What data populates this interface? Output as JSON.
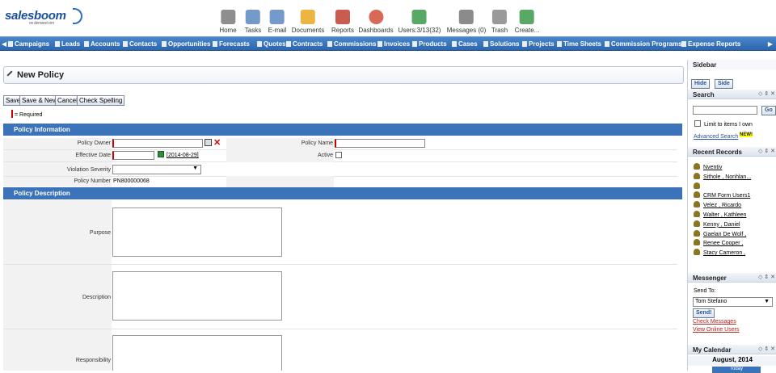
{
  "brand": {
    "name": "salesboom",
    "tagline": "on demand crm"
  },
  "toolbar": [
    {
      "label": "Home",
      "icon": "home-icon"
    },
    {
      "label": "Tasks",
      "icon": "tasks-icon"
    },
    {
      "label": "E-mail",
      "icon": "email-icon"
    },
    {
      "label": "Documents",
      "icon": "folder-icon"
    },
    {
      "label": "Reports",
      "icon": "reports-icon"
    },
    {
      "label": "Dashboards",
      "icon": "dashboard-icon"
    },
    {
      "label": "Users:3/13(32)",
      "icon": "users-icon"
    },
    {
      "label": "Messages (0)",
      "icon": "messages-icon"
    },
    {
      "label": "Trash",
      "icon": "trash-icon"
    },
    {
      "label": "Create...",
      "icon": "create-icon"
    }
  ],
  "nav": [
    "Campaigns",
    "Leads",
    "Accounts",
    "Contacts",
    "Opportunities",
    "Forecasts",
    "Quotes",
    "Contracts",
    "Commissions",
    "Invoices",
    "Products",
    "Cases",
    "Solutions",
    "Projects",
    "Time Sheets",
    "Commission Programs",
    "Expense Reports"
  ],
  "page": {
    "title": "New Policy"
  },
  "buttons": {
    "save": "Save",
    "save_new": "Save & New",
    "cancel": "Cancel",
    "spell": "Check Spelling"
  },
  "required_note": "= Required",
  "section1": "Policy Information",
  "section2": "Policy Description",
  "fields": {
    "policy_owner": "Policy Owner",
    "effective_date": "Effective Date",
    "date_value": "[2014-08-29]",
    "violation_severity": "Violation Severity",
    "policy_number": "Policy Number",
    "policy_number_value": "PN800000068",
    "policy_name": "Policy Name",
    "active": "Active",
    "purpose": "Purpose",
    "description": "Description",
    "responsibility": "Responsibility"
  },
  "sidebar": {
    "title": "Sidebar",
    "hide": "Hide",
    "side": "Side",
    "search_title": "Search",
    "go": "Go",
    "limit": "Limit to items I own",
    "advanced": "Advanced Search",
    "new_badge": "NEW!",
    "recent_title": "Recent Records",
    "recent": [
      "Nventiv",
      "Sithole , Nonhlan...",
      "",
      "CRM Form Users1",
      "Velez , Ricardo",
      "Walter , Kathleen",
      "Kenny , Daniel",
      "Gaelan De Wolf ,",
      "Renee Cooper ,",
      "Stacy Cameron ,"
    ],
    "messenger_title": "Messenger",
    "send_to": "Send To:",
    "recipient": "Tom Stefano",
    "send": "Send!",
    "check_messages": "Check Messages",
    "view_online": "View Online Users",
    "calendar_title": "My Calendar",
    "month": "August, 2014",
    "today": "Today"
  },
  "colors": {
    "nav": "#2c66ae",
    "section": "#3a73b9",
    "required": "#cc0000"
  }
}
